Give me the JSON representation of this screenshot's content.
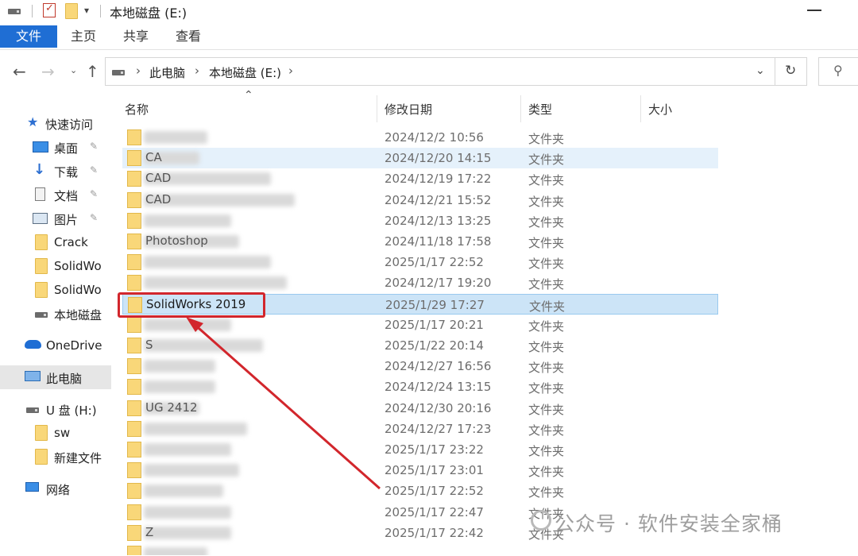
{
  "window": {
    "title": "本地磁盘 (E:)"
  },
  "ribbon": {
    "tabs": [
      "文件",
      "主页",
      "共享",
      "查看"
    ]
  },
  "breadcrumb": [
    "此电脑",
    "本地磁盘 (E:)"
  ],
  "nav": {
    "items": [
      {
        "label": "快速访问",
        "icon": "star-icon",
        "pinned": false
      },
      {
        "label": "桌面",
        "icon": "desktop-icon",
        "pinned": true
      },
      {
        "label": "下载",
        "icon": "download-icon",
        "pinned": true
      },
      {
        "label": "文档",
        "icon": "document-icon",
        "pinned": true
      },
      {
        "label": "图片",
        "icon": "pictures-icon",
        "pinned": true
      },
      {
        "label": "Crack",
        "icon": "folder-icon",
        "pinned": false
      },
      {
        "label": "SolidWo",
        "icon": "folder-icon",
        "pinned": false
      },
      {
        "label": "SolidWo",
        "icon": "folder-icon",
        "pinned": false
      },
      {
        "label": "本地磁盘",
        "icon": "drive-icon",
        "pinned": false
      },
      {
        "label": "OneDrive",
        "icon": "cloud-icon",
        "pinned": false
      },
      {
        "label": "此电脑",
        "icon": "computer-icon",
        "pinned": false,
        "selected": true
      },
      {
        "label": "U 盘 (H:)",
        "icon": "drive-icon",
        "pinned": false
      },
      {
        "label": "sw",
        "icon": "folder-icon",
        "pinned": false
      },
      {
        "label": "新建文件",
        "icon": "folder-icon",
        "pinned": false
      },
      {
        "label": "网络",
        "icon": "network-icon",
        "pinned": false
      }
    ]
  },
  "columns": {
    "name": "名称",
    "modified": "修改日期",
    "type": "类型",
    "size": "大小"
  },
  "files": [
    {
      "name": "",
      "date": "2024/12/2 10:56",
      "type": "文件夹"
    },
    {
      "name": "CA",
      "date": "2024/12/20 14:15",
      "type": "文件夹",
      "hover": true
    },
    {
      "name": "CAD",
      "date": "2024/12/19 17:22",
      "type": "文件夹"
    },
    {
      "name": "CAD",
      "date": "2024/12/21 15:52",
      "type": "文件夹"
    },
    {
      "name": "",
      "date": "2024/12/13 13:25",
      "type": "文件夹"
    },
    {
      "name": "Photoshop",
      "date": "2024/11/18 17:58",
      "type": "文件夹"
    },
    {
      "name": "",
      "date": "2025/1/17 22:52",
      "type": "文件夹"
    },
    {
      "name": "",
      "date": "2024/12/17 19:20",
      "type": "文件夹"
    },
    {
      "name": "SolidWorks 2019",
      "date": "2025/1/29 17:27",
      "type": "文件夹",
      "selected": true
    },
    {
      "name": "",
      "date": "2025/1/17 20:21",
      "type": "文件夹"
    },
    {
      "name": "S",
      "date": "2025/1/22 20:14",
      "type": "文件夹"
    },
    {
      "name": "",
      "date": "2024/12/27 16:56",
      "type": "文件夹"
    },
    {
      "name": "",
      "date": "2024/12/24 13:15",
      "type": "文件夹"
    },
    {
      "name": "UG 2412",
      "date": "2024/12/30 20:16",
      "type": "文件夹"
    },
    {
      "name": "",
      "date": "2024/12/27 17:23",
      "type": "文件夹"
    },
    {
      "name": "",
      "date": "2025/1/17 23:22",
      "type": "文件夹"
    },
    {
      "name": "",
      "date": "2025/1/17 23:01",
      "type": "文件夹"
    },
    {
      "name": "",
      "date": "2025/1/17 22:52",
      "type": "文件夹"
    },
    {
      "name": "",
      "date": "2025/1/17 22:47",
      "type": "文件夹"
    },
    {
      "name": "Z",
      "date": "2025/1/17 22:42",
      "type": "文件夹"
    },
    {
      "name": "",
      "date": "",
      "type": ""
    }
  ],
  "watermark": "公众号 · 软件安装全家桶",
  "colors": {
    "accent": "#1f6ed4",
    "highlight": "#d2262c",
    "selected_row": "#cce4f7",
    "folder": "#f9d779"
  }
}
